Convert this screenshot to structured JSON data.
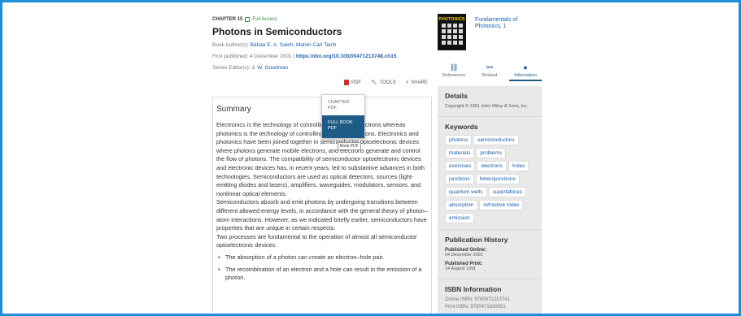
{
  "chapter": {
    "label": "CHAPTER 15",
    "access": "Full Access",
    "title": "Photons in Semiconductors",
    "authors_label": "Book Author(s):",
    "authors": "Bahaa E. A. Saleh, Malvin Carl Teich",
    "published_label": "First published:",
    "published": "4 December 2001",
    "separator": "|",
    "doi": "https://doi.org/10.1002/0471213748.ch15",
    "editors_label": "Series Editor(s):",
    "editors": "J. W. Goodman"
  },
  "toolbar": {
    "pdf": "PDF",
    "tools": "TOOLS",
    "share": "SHARE"
  },
  "dropdown": {
    "chapter_pdf": "CHAPTER PDF",
    "full_book_pdf": "FULL BOOK PDF",
    "tooltip": "Book PDF"
  },
  "summary": {
    "title": "Summary",
    "p1": "Electronics is the technology of controlling the flow of electrons whereas photonics is the technology of controlling the flow of photons. Electronics and photonics have been joined together in semiconductor optoelectronic devices where photons generate mobile electrons, and electrons generate and control the flow of photons. The compatibility of semiconductor optoelectronic devices and electronic devices has, in recent years, led to substantive advances in both technologies. Semiconductors are used as optical detectors, sources (light-emitting diodes and lasers), amplifiers, waveguides, modulators, sensors, and nonlinear optical elements.",
    "p2": "Semiconductors absorb and emit photons by undergoing transitions between different allowed energy levels, in accordance with the general theory of photon–atom interactions. However, as we indicated briefly earlier, semiconductors have properties that are unique in certain respects:",
    "p3": "Two processes are fundamental to the operation of almost all semiconductor optoelectronic devices:",
    "bullets": [
      "The absorption of a photon can create an electron–hole pair.",
      "The recombination of an electron and a hole can result in the emission of a photon."
    ]
  },
  "book": {
    "cover_text": "PHOTONICS",
    "title": "Fundamentals of Photonics, 1"
  },
  "tabs": [
    {
      "label": "References",
      "icon": "link-icon"
    },
    {
      "label": "Related",
      "icon": "network-icon"
    },
    {
      "label": "Information",
      "icon": "info-icon"
    }
  ],
  "details": {
    "heading": "Details",
    "copyright": "Copyright © 1991 John Wiley & Sons, Inc."
  },
  "keywords": {
    "heading": "Keywords",
    "items": [
      "photons",
      "semiconductors",
      "materials",
      "problems",
      "exercises",
      "electrons",
      "holes",
      "junctions",
      "heterojunctions",
      "quantum wells",
      "superlattices",
      "absorption",
      "refractive index",
      "emission"
    ]
  },
  "history": {
    "heading": "Publication History",
    "online_label": "Published Online:",
    "online": "04 December 2001",
    "print_label": "Published Print:",
    "print": "14 August 1991"
  },
  "isbn": {
    "heading": "ISBN Information",
    "online": "Online ISBN: 9780471213741",
    "print": "Print ISBN: 9780471839651"
  },
  "colors": {
    "frame": "#1e8fd6",
    "accent": "#1f5b87",
    "link": "#1a5fa8",
    "access": "#2a8f3a"
  }
}
